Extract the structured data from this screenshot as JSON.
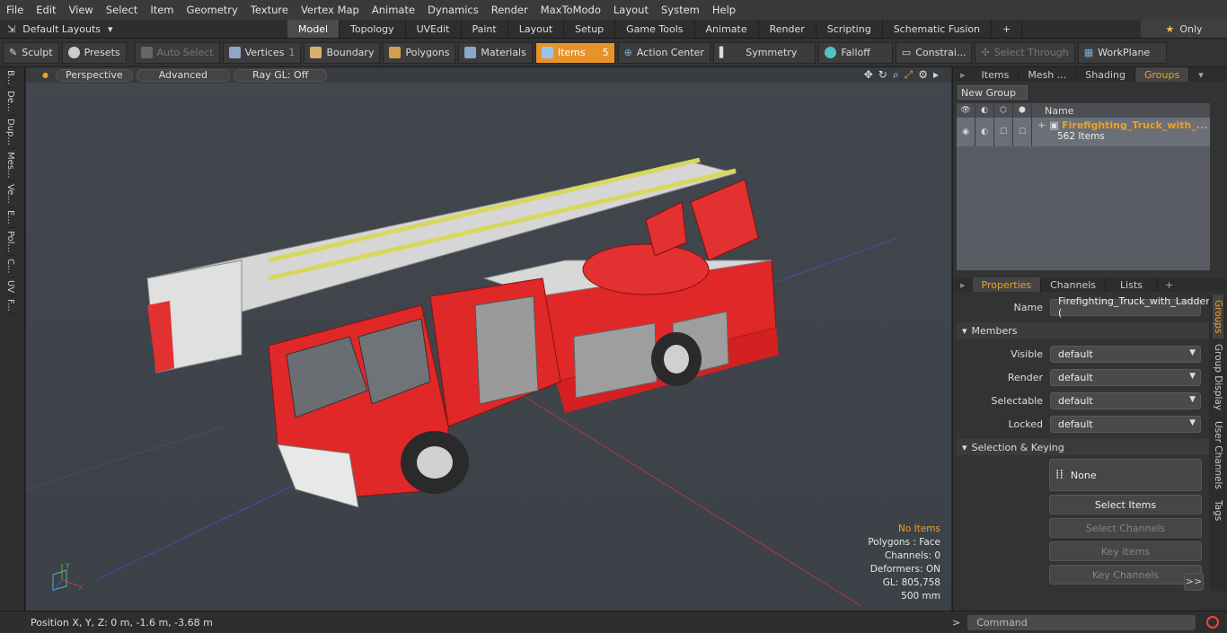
{
  "menubar": [
    "File",
    "Edit",
    "View",
    "Select",
    "Item",
    "Geometry",
    "Texture",
    "Vertex Map",
    "Animate",
    "Dynamics",
    "Render",
    "MaxToModo",
    "Layout",
    "System",
    "Help"
  ],
  "layouts_label": "Default Layouts",
  "main_tabs": [
    "Model",
    "Topology",
    "UVEdit",
    "Paint",
    "Layout",
    "Setup",
    "Game Tools",
    "Animate",
    "Render",
    "Scripting",
    "Schematic Fusion"
  ],
  "only_label": "Only",
  "toolbar": {
    "sculpt": "Sculpt",
    "presets": "Presets",
    "auto_select": "Auto Select",
    "vertices": "Vertices",
    "vertices_count": "1",
    "boundary": "Boundary",
    "polygons": "Polygons",
    "materials": "Materials",
    "items": "Items",
    "items_count": "5",
    "action_center": "Action Center",
    "symmetry": "Symmetry",
    "falloff": "Falloff",
    "constraints": "Constrai...",
    "select_through": "Select Through",
    "workplane": "WorkPlane"
  },
  "left_strip": [
    "B...",
    "De...",
    "Dup...",
    "Mes...",
    "Ve...",
    "E...",
    "Pol...",
    "C...",
    "UV",
    "F..."
  ],
  "viewport": {
    "perspective": "Perspective",
    "advanced": "Advanced",
    "raygl": "Ray GL: Off",
    "info": {
      "items": "No Items",
      "polygons": "Polygons : Face",
      "channels": "Channels: 0",
      "deformers": "Deformers: ON",
      "gl": "GL: 805,758",
      "unit": "500 mm"
    }
  },
  "status": {
    "position": "Position X, Y, Z:   0 m, -1.6 m, -3.68 m",
    "command": "Command"
  },
  "groups_panel": {
    "tabs": [
      "Items",
      "Mesh ...",
      "Shading",
      "Groups"
    ],
    "new_group": "New Group",
    "name_header": "Name",
    "group_name": "Firefighting_Truck_with_...",
    "group_count": "562 Items"
  },
  "properties": {
    "tabs": [
      "Properties",
      "Channels",
      "Lists"
    ],
    "name_label": "Name",
    "name_value": "Firefighting_Truck_with_Ladder (",
    "members_label": "Members",
    "visible_label": "Visible",
    "visible_value": "default",
    "render_label": "Render",
    "render_value": "default",
    "selectable_label": "Selectable",
    "selectable_value": "default",
    "locked_label": "Locked",
    "locked_value": "default",
    "sel_keying_label": "Selection & Keying",
    "none_label": "None",
    "select_items": "Select Items",
    "select_channels": "Select Channels",
    "key_items": "Key Items",
    "key_channels": "Key Channels",
    "more": ">>",
    "side_tabs": [
      "Groups",
      "Group Display",
      "User Channels",
      "Tags"
    ]
  }
}
